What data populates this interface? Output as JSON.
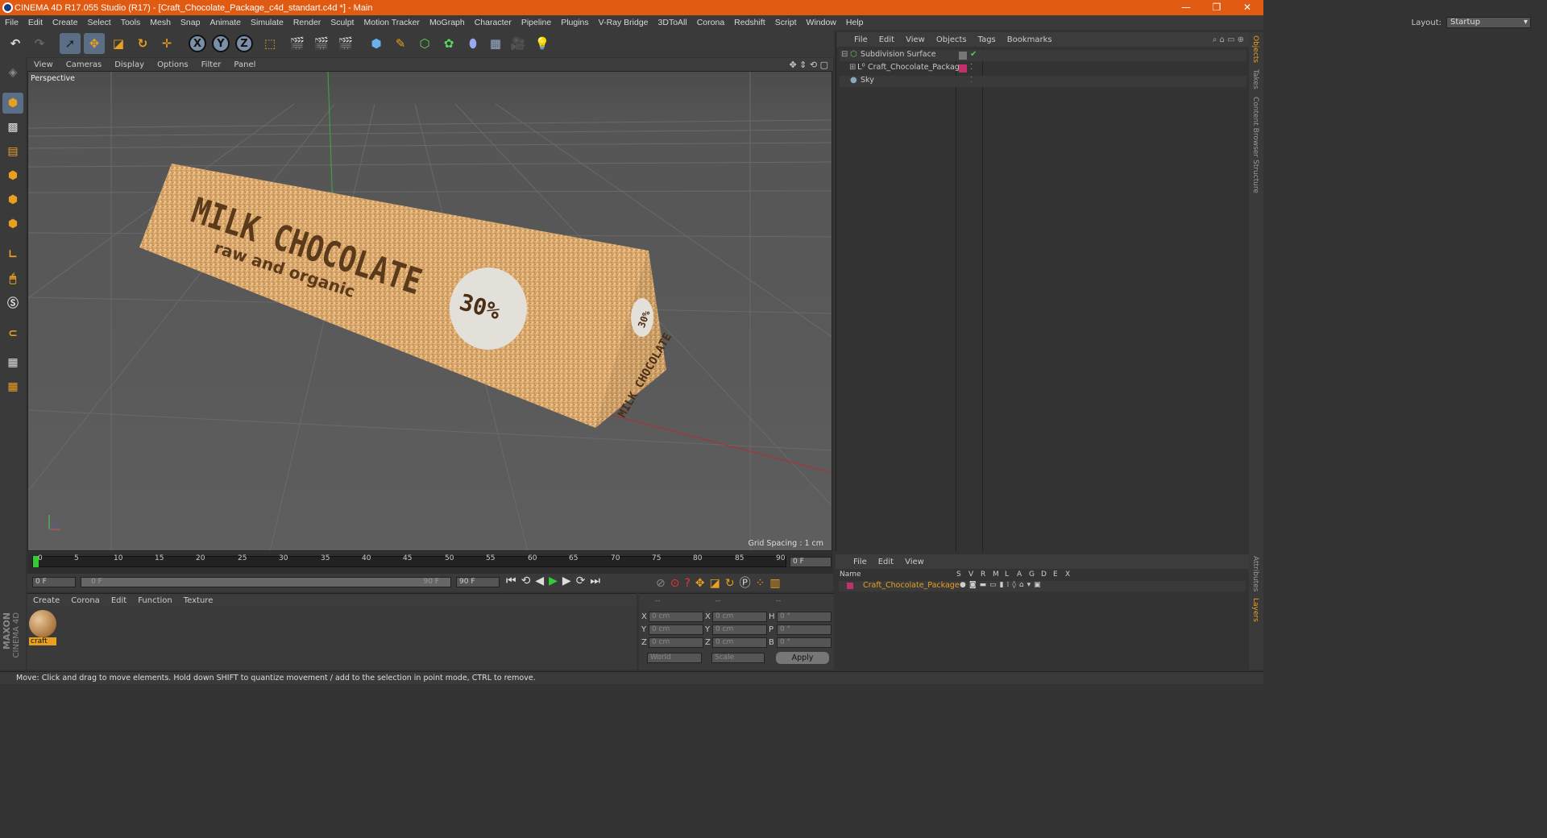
{
  "window": {
    "title": "CINEMA 4D R17.055 Studio (R17) - [Craft_Chocolate_Package_c4d_standart.c4d *] - Main",
    "min_glyph": "—",
    "restore_glyph": "❐",
    "close_glyph": "✕"
  },
  "menu": [
    "File",
    "Edit",
    "Create",
    "Select",
    "Tools",
    "Mesh",
    "Snap",
    "Animate",
    "Simulate",
    "Render",
    "Sculpt",
    "Motion Tracker",
    "MoGraph",
    "Character",
    "Pipeline",
    "Plugins",
    "V-Ray Bridge",
    "3DToAll",
    "Corona",
    "Redshift",
    "Script",
    "Window",
    "Help"
  ],
  "layout": {
    "label": "Layout:",
    "value": "Startup"
  },
  "toolbar": {
    "x": "X",
    "y": "Y",
    "z": "Z"
  },
  "viewport": {
    "menu": [
      "View",
      "Cameras",
      "Display",
      "Options",
      "Filter",
      "Panel"
    ],
    "label": "Perspective",
    "grid": "Grid Spacing : 1 cm",
    "package": {
      "headline": "MILK CHOCOLATE",
      "subline": "raw and organic",
      "badge": "30%",
      "side_badge": "30%",
      "side_text": "MILK CHOCOLATE"
    }
  },
  "timeline": {
    "ticks": [
      "0",
      "5",
      "10",
      "15",
      "20",
      "25",
      "30",
      "35",
      "40",
      "45",
      "50",
      "55",
      "60",
      "65",
      "70",
      "75",
      "80",
      "85",
      "90"
    ],
    "current": "0 F"
  },
  "tlcontrols": {
    "start": "0 F",
    "range_start": "0 F",
    "range_end": "90 F",
    "end": "90 F"
  },
  "matmgr": {
    "menu": [
      "Create",
      "Corona",
      "Edit",
      "Function",
      "Texture"
    ],
    "material": "craft",
    "brand1": "MAXON",
    "brand2": "CINEMA 4D"
  },
  "coords": {
    "head": [
      "--",
      "--",
      "--"
    ],
    "rows": [
      {
        "a": "X",
        "v1": "0 cm",
        "b": "X",
        "v2": "0 cm",
        "c": "H",
        "v3": "0 °"
      },
      {
        "a": "Y",
        "v1": "0 cm",
        "b": "Y",
        "v2": "0 cm",
        "c": "P",
        "v3": "0 °"
      },
      {
        "a": "Z",
        "v1": "0 cm",
        "b": "Z",
        "v2": "0 cm",
        "c": "B",
        "v3": "0 °"
      }
    ],
    "mode1": "World",
    "mode2": "Scale",
    "apply": "Apply"
  },
  "objmgr": {
    "menu": [
      "File",
      "Edit",
      "View",
      "Objects",
      "Tags",
      "Bookmarks"
    ],
    "objects": [
      {
        "name": "Subdivision Surface",
        "indent": 0,
        "color": "#66cc66"
      },
      {
        "name": "Craft_Chocolate_Package",
        "indent": 1,
        "color": "#c8c8c8"
      },
      {
        "name": "Sky",
        "indent": 0,
        "color": "#c8c8c8"
      }
    ]
  },
  "attrmgr": {
    "menu": [
      "File",
      "Edit",
      "View"
    ],
    "cols": [
      "Name",
      "S",
      "V",
      "R",
      "M",
      "L",
      "A",
      "G",
      "D",
      "E",
      "X"
    ],
    "row": "Craft_Chocolate_Package"
  },
  "rightstrip": {
    "tabs": [
      "Objects",
      "Takes",
      "Content Browser",
      "Structure"
    ],
    "tabs2": [
      "Attributes",
      "Layers"
    ]
  },
  "status": "Move: Click and drag to move elements. Hold down SHIFT to quantize movement / add to the selection in point mode, CTRL to remove."
}
